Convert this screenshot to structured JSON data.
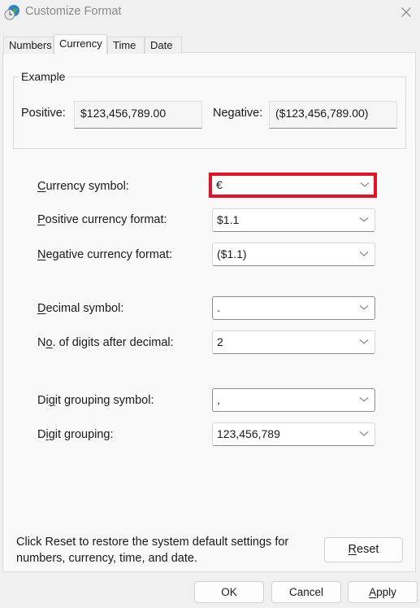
{
  "window": {
    "title": "Customize Format",
    "icon": "globe-clock-icon",
    "close_icon": "close-icon"
  },
  "tabs": [
    {
      "label": "Numbers",
      "active": false
    },
    {
      "label": "Currency",
      "active": true
    },
    {
      "label": "Time",
      "active": false
    },
    {
      "label": "Date",
      "active": false
    }
  ],
  "example": {
    "title": "Example",
    "positive_label": "Positive:",
    "positive_value": "$123,456,789.00",
    "negative_label": "Negative:",
    "negative_value": "($123,456,789.00)"
  },
  "fields": [
    {
      "label_pre": "",
      "label_u": "C",
      "label_post": "urrency symbol:",
      "value": "€",
      "highlighted": true
    },
    {
      "label_pre": "",
      "label_u": "P",
      "label_post": "ositive currency format:",
      "value": "$1.1"
    },
    {
      "label_pre": "",
      "label_u": "N",
      "label_post": "egative currency format:",
      "value": "($1.1)"
    },
    {
      "label_pre": "",
      "label_u": "D",
      "label_post": "ecimal symbol:",
      "value": "."
    },
    {
      "label_pre": "N",
      "label_u": "o",
      "label_post": ". of digits after decimal:",
      "value": "2"
    },
    {
      "label_pre": "Di",
      "label_u": "g",
      "label_post": "it grouping symbol:",
      "value": ","
    },
    {
      "label_pre": "D",
      "label_u": "i",
      "label_post": "git grouping:",
      "value": "123,456,789"
    }
  ],
  "footer": {
    "text_line1": "Click Reset to restore the system default settings for",
    "text_line2": "numbers, currency, time, and date.",
    "reset_u": "R",
    "reset_rest": "eset"
  },
  "buttons": {
    "ok": "OK",
    "cancel": "Cancel",
    "apply_u": "A",
    "apply_rest": "pply"
  },
  "colors": {
    "highlight": "#e81123"
  }
}
